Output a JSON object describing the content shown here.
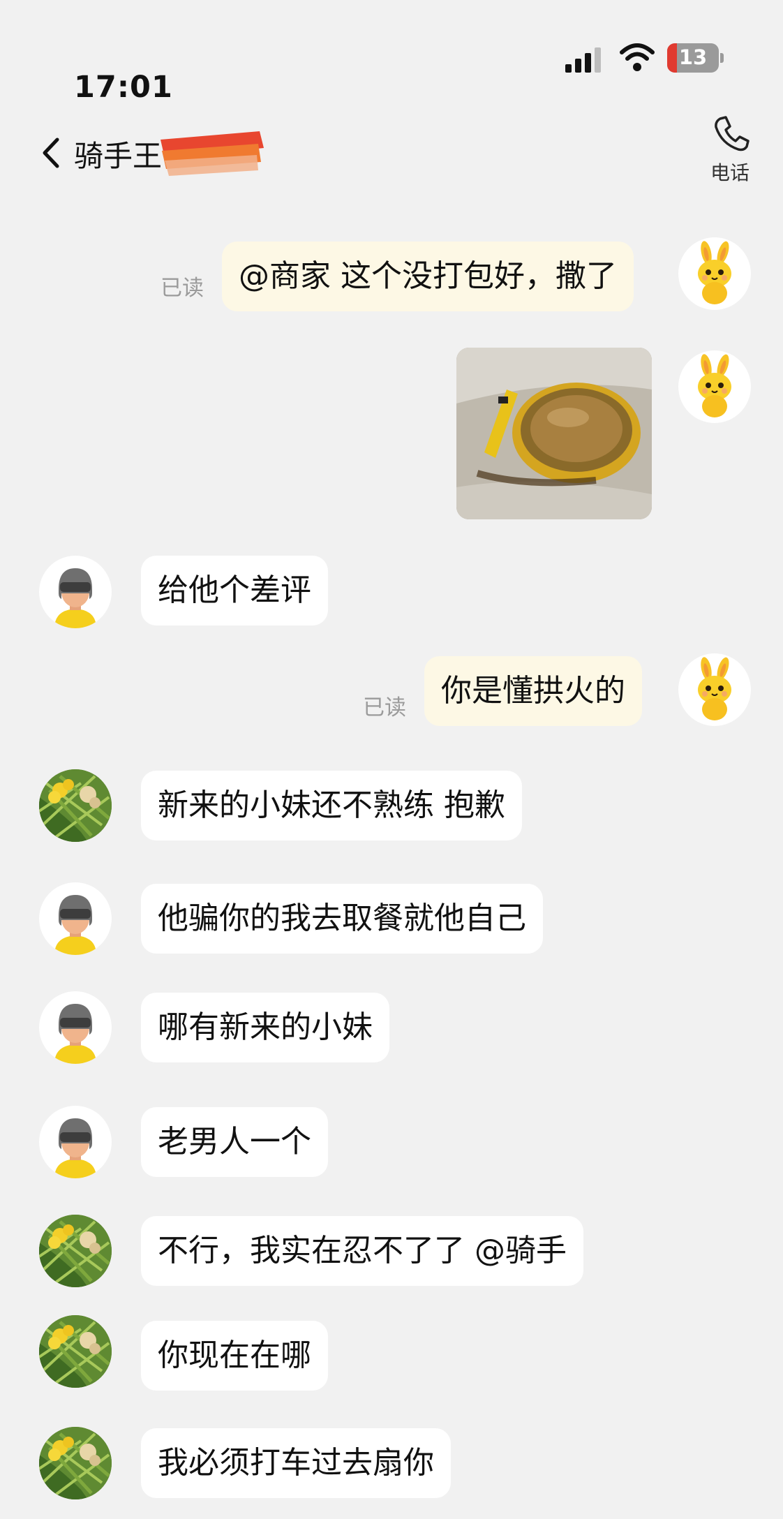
{
  "status_bar": {
    "time": "17:01",
    "battery": "13"
  },
  "header": {
    "contact_name": "骑手王",
    "call_label": "电话"
  },
  "read_label": "已读",
  "messages": [
    {
      "sender": "me",
      "text": "@商家 这个没打包好，撒了",
      "read": true
    },
    {
      "sender": "me",
      "type": "image"
    },
    {
      "sender": "rider",
      "text": "给他个差评"
    },
    {
      "sender": "me",
      "text": "你是懂拱火的",
      "read": true
    },
    {
      "sender": "shop",
      "text": "新来的小妹还不熟练 抱歉"
    },
    {
      "sender": "rider",
      "text": "他骗你的我去取餐就他自己"
    },
    {
      "sender": "rider",
      "text": "哪有新来的小妹"
    },
    {
      "sender": "rider",
      "text": "老男人一个"
    },
    {
      "sender": "shop",
      "text": "不行，我实在忍不了了 @骑手"
    },
    {
      "sender": "shop",
      "text": "你现在在哪"
    },
    {
      "sender": "shop",
      "text": "我必须打车过去扇你"
    }
  ],
  "colors": {
    "incoming_bubble": "#ffffff",
    "outgoing_bubble": "#fdf8e5",
    "background": "#f1f1f1"
  }
}
